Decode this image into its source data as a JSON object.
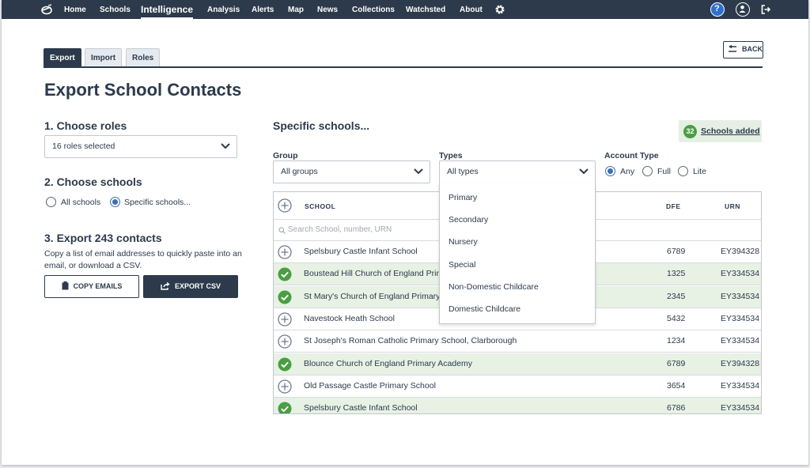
{
  "nav": {
    "items": [
      {
        "label": "Home",
        "active": false
      },
      {
        "label": "Schools",
        "active": false
      },
      {
        "label": "Intelligence",
        "active": true
      },
      {
        "label": "Analysis",
        "active": false
      },
      {
        "label": "Alerts",
        "active": false
      },
      {
        "label": "Map",
        "active": false
      },
      {
        "label": "News",
        "active": false
      },
      {
        "label": "Collections",
        "active": false
      },
      {
        "label": "Watchsted",
        "active": false
      },
      {
        "label": "About",
        "active": false
      }
    ],
    "icons": [
      "logo-icon",
      "gear-icon",
      "help-icon",
      "user-icon",
      "logout-icon"
    ]
  },
  "tabs": [
    {
      "label": "Export",
      "active": true
    },
    {
      "label": "Import",
      "active": false
    },
    {
      "label": "Roles",
      "active": false
    }
  ],
  "back_label": "BACK",
  "page_title": "Export School Contacts",
  "roles": {
    "heading": "1. Choose roles",
    "selected": "16 roles selected"
  },
  "schools_choice": {
    "heading": "2. Choose schools",
    "options": [
      {
        "label": "All schools",
        "selected": false
      },
      {
        "label": "Specific schools...",
        "selected": true
      }
    ]
  },
  "export": {
    "heading": "3. Export 243 contacts",
    "description": "Copy a list of email addresses to quickly paste into an email, or download a CSV.",
    "copy_label": "COPY EMAILS",
    "csv_label": "EXPORT CSV"
  },
  "specific": {
    "heading": "Specific schools...",
    "added_count": "32",
    "added_label": "Schools added"
  },
  "filters": {
    "group_label": "Group",
    "group_value": "All groups",
    "types_label": "Types",
    "types_value": "All types",
    "types_open": true,
    "types_options": [
      "Primary",
      "Secondary",
      "Nursery",
      "Special",
      "Non-Domestic Childcare",
      "Domestic Childcare"
    ],
    "account_label": "Account Type",
    "account_options": [
      {
        "label": "Any",
        "selected": true
      },
      {
        "label": "Full",
        "selected": false
      },
      {
        "label": "Lite",
        "selected": false
      }
    ]
  },
  "table": {
    "headers": {
      "school": "SCHOOL",
      "dfe": "DFE",
      "urn": "URN"
    },
    "search_placeholder": "Search School, number, URN",
    "rows": [
      {
        "name": "Spelsbury Castle Infant School",
        "dfe": "6789",
        "urn": "EY394328",
        "added": false
      },
      {
        "name": "Boustead Hill Church of England Primary School",
        "dfe": "1325",
        "urn": "EY334534",
        "added": true
      },
      {
        "name": "St Mary's Church of England Primary School",
        "dfe": "2345",
        "urn": "EY334534",
        "added": true
      },
      {
        "name": "Navestock Heath School",
        "dfe": "5432",
        "urn": "EY334534",
        "added": false
      },
      {
        "name": "St Joseph's Roman Catholic Primary School, Clarborough",
        "dfe": "1234",
        "urn": "EY334534",
        "added": false
      },
      {
        "name": "Blounce Church of England Primary Academy",
        "dfe": "6789",
        "urn": "EY394328",
        "added": true
      },
      {
        "name": "Old Passage Castle Primary School",
        "dfe": "3654",
        "urn": "EY334534",
        "added": false
      },
      {
        "name": "Spelsbury Castle Infant School",
        "dfe": "6786",
        "urn": "EY334534",
        "added": true
      }
    ]
  },
  "colors": {
    "navy": "#2c3a4b",
    "added_green": "#4a9e44",
    "added_row": "#e7f1e4",
    "radio_blue": "#3d6fb6",
    "help_blue": "#2f6fd1"
  }
}
